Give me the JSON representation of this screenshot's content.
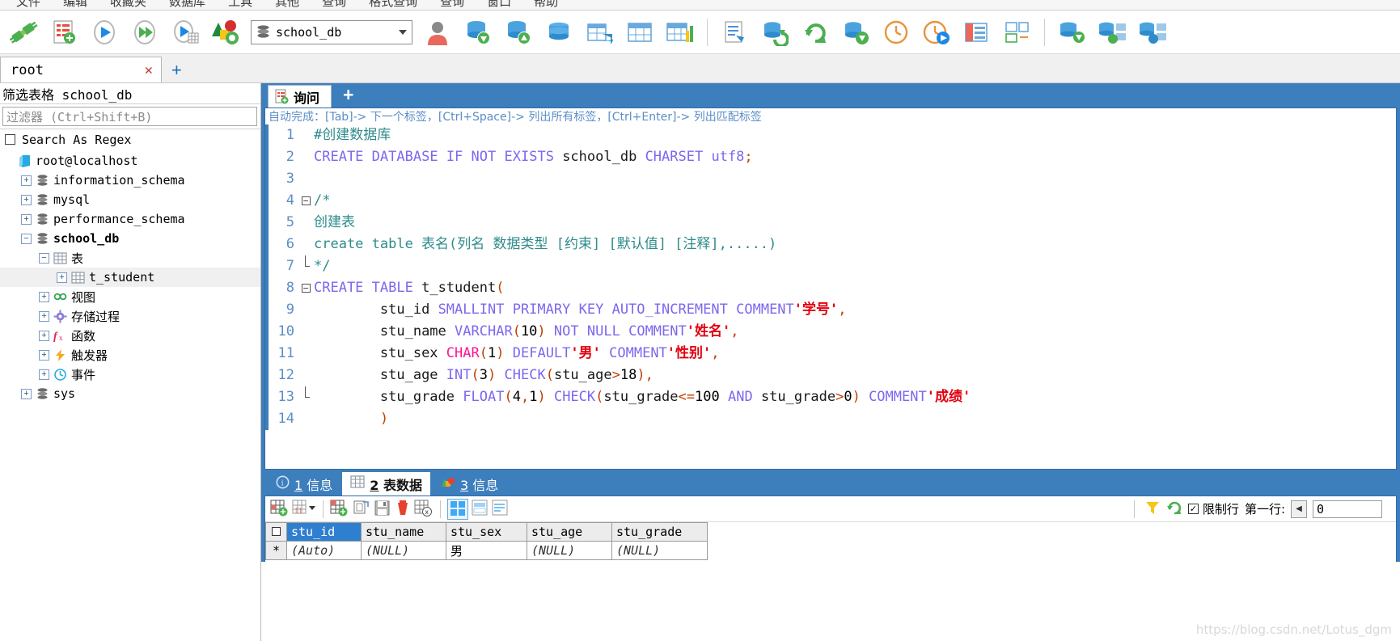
{
  "menu": {
    "items": [
      "文件",
      "编辑",
      "收藏夹",
      "数据库",
      "工具",
      "其他",
      "查询",
      "格式查询",
      "查询",
      "窗口",
      "帮助"
    ]
  },
  "toolbar": {
    "buttons": [
      {
        "name": "new-session-connect",
        "icon": "plug-connect-icon"
      },
      {
        "name": "new-query-tab",
        "icon": "new-query-icon"
      },
      {
        "name": "run-sql",
        "icon": "run-icon"
      },
      {
        "name": "run-all-sql",
        "icon": "run-all-icon"
      },
      {
        "name": "run-current-sql",
        "icon": "run-current-icon"
      },
      {
        "name": "stop-refresh",
        "icon": "stop-refresh-icon"
      }
    ],
    "database_select": {
      "value": "school_db",
      "icon": "database-icon"
    },
    "buttons2": [
      {
        "name": "user-manager",
        "icon": "user-icon"
      },
      {
        "name": "import-data",
        "icon": "db-down-icon"
      },
      {
        "name": "export-data",
        "icon": "db-up-icon"
      },
      {
        "name": "flush-db",
        "icon": "db-blue-icon"
      },
      {
        "name": "table-export",
        "icon": "table-arrow-icon"
      },
      {
        "name": "table-grid",
        "icon": "table-icon"
      },
      {
        "name": "table-diagnose",
        "icon": "table-chart-icon"
      },
      {
        "name": "sql-editor",
        "icon": "sql-doc-icon"
      },
      {
        "name": "refresh-db",
        "icon": "refresh-db-icon"
      },
      {
        "name": "refresh",
        "icon": "refresh-icon"
      },
      {
        "name": "sync-db",
        "icon": "sync-db-icon"
      },
      {
        "name": "history",
        "icon": "clock-icon"
      },
      {
        "name": "schedule",
        "icon": "clock-run-icon"
      },
      {
        "name": "layout-panel",
        "icon": "panel-icon"
      },
      {
        "name": "layout-split",
        "icon": "split-icon"
      },
      {
        "name": "db-tools-1",
        "icon": "db-stack-icon"
      },
      {
        "name": "db-tools-2",
        "icon": "db-stack-arrow-icon"
      },
      {
        "name": "db-tools-3",
        "icon": "db-stack-arrow2-icon"
      }
    ]
  },
  "session_tab": {
    "label": "root",
    "close": "✕",
    "add": "+"
  },
  "sidebar": {
    "title": "筛选表格 school_db",
    "filter_placeholder": "过滤器 (Ctrl+Shift+B)",
    "regex_label": "Search As Regex",
    "regex_checked": false,
    "tree": [
      {
        "label": "root@localhost",
        "icon": "server-icon",
        "indent": 0,
        "expander": "",
        "bold": false
      },
      {
        "label": "information_schema",
        "icon": "database-icon",
        "indent": 1,
        "expander": "+",
        "bold": false
      },
      {
        "label": "mysql",
        "icon": "database-icon",
        "indent": 1,
        "expander": "+",
        "bold": false
      },
      {
        "label": "performance_schema",
        "icon": "database-icon",
        "indent": 1,
        "expander": "+",
        "bold": false
      },
      {
        "label": "school_db",
        "icon": "database-icon",
        "indent": 1,
        "expander": "−",
        "bold": true
      },
      {
        "label": "表",
        "icon": "table-icon",
        "indent": 2,
        "expander": "−",
        "bold": false
      },
      {
        "label": "t_student",
        "icon": "table-icon",
        "indent": 3,
        "expander": "+",
        "bold": false,
        "selected": true
      },
      {
        "label": "视图",
        "icon": "view-icon",
        "indent": 2,
        "expander": "+",
        "bold": false
      },
      {
        "label": "存储过程",
        "icon": "procedure-icon",
        "indent": 2,
        "expander": "+",
        "bold": false
      },
      {
        "label": "函数",
        "icon": "function-icon",
        "indent": 2,
        "expander": "+",
        "bold": false
      },
      {
        "label": "触发器",
        "icon": "trigger-icon",
        "indent": 2,
        "expander": "+",
        "bold": false
      },
      {
        "label": "事件",
        "icon": "event-icon",
        "indent": 2,
        "expander": "+",
        "bold": false
      },
      {
        "label": "sys",
        "icon": "database-icon",
        "indent": 1,
        "expander": "+",
        "bold": false
      }
    ]
  },
  "query": {
    "tab_label": "询问",
    "tab_add": "+",
    "hint": "自动完成：[Tab]-> 下一个标签，[Ctrl+Space]-> 列出所有标签，[Ctrl+Enter]-> 列出匹配标签",
    "lines": [
      {
        "n": "1",
        "text": "#创建数据库"
      },
      {
        "n": "2",
        "text": "CREATE DATABASE IF NOT EXISTS school_db CHARSET utf8;"
      },
      {
        "n": "3",
        "text": ""
      },
      {
        "n": "4",
        "text": "/*"
      },
      {
        "n": "5",
        "text": "创建表"
      },
      {
        "n": "6",
        "text": "create table 表名(列名 数据类型 [约束] [默认值] [注释],.....)"
      },
      {
        "n": "7",
        "text": "*/"
      },
      {
        "n": "8",
        "text": "CREATE TABLE t_student("
      },
      {
        "n": "9",
        "text": "        stu_id SMALLINT PRIMARY KEY AUTO_INCREMENT COMMENT'学号',"
      },
      {
        "n": "10",
        "text": "        stu_name VARCHAR(10) NOT NULL COMMENT'姓名',"
      },
      {
        "n": "11",
        "text": "        stu_sex CHAR(1) DEFAULT'男' COMMENT'性别',"
      },
      {
        "n": "12",
        "text": "        stu_age INT(3) CHECK(stu_age>18),"
      },
      {
        "n": "13",
        "text": "        stu_grade FLOAT(4,1) CHECK(stu_grade<=100 AND stu_grade>0) COMMENT'成绩'"
      },
      {
        "n": "14",
        "text": "        )"
      }
    ]
  },
  "result_tabs": [
    {
      "num": "1",
      "label": "信息",
      "icon": "info-icon",
      "active": false
    },
    {
      "num": "2",
      "label": "表数据",
      "icon": "table-icon",
      "active": true
    },
    {
      "num": "3",
      "label": "信息",
      "icon": "chart-icon",
      "active": false
    }
  ],
  "grid_toolbar": {
    "buttons": [
      {
        "name": "grid-insert-row",
        "icon": "grid-add-icon"
      },
      {
        "name": "grid-set-null",
        "icon": "grid-null-icon"
      },
      {
        "name": "grid-new-row",
        "icon": "grid-new-icon"
      },
      {
        "name": "grid-duplicate-row",
        "icon": "grid-duplicate-icon"
      },
      {
        "name": "grid-save",
        "icon": "save-icon"
      },
      {
        "name": "grid-delete-row",
        "icon": "delete-icon"
      },
      {
        "name": "grid-cancel",
        "icon": "grid-cancel-icon"
      },
      {
        "name": "view-grid",
        "icon": "view-grid-icon"
      },
      {
        "name": "view-form",
        "icon": "view-form-icon"
      },
      {
        "name": "view-text",
        "icon": "view-text-icon"
      }
    ],
    "filter_icon": "funnel-icon",
    "refresh_icon": "refresh-green-icon",
    "limit_checkbox_label": "限制行",
    "limit_checked": true,
    "first_row_label": "第一行:",
    "first_row_value": "0",
    "spinner_icon": "left-arrow-icon"
  },
  "data_grid": {
    "columns": [
      "stu_id",
      "stu_name",
      "stu_sex",
      "stu_age",
      "stu_grade"
    ],
    "selected_column": "stu_id",
    "row_marker": "*",
    "rows": [
      [
        "(Auto)",
        "(NULL)",
        "男",
        "(NULL)",
        "(NULL)"
      ]
    ]
  },
  "watermark": "https://blog.csdn.net/Lotus_dgm",
  "colors": {
    "accent": "#3d7ebd",
    "keyword": "#7b68ee",
    "string": "#e3000f",
    "comment": "#2e8b8b",
    "gutter": "#5b8ec7"
  }
}
